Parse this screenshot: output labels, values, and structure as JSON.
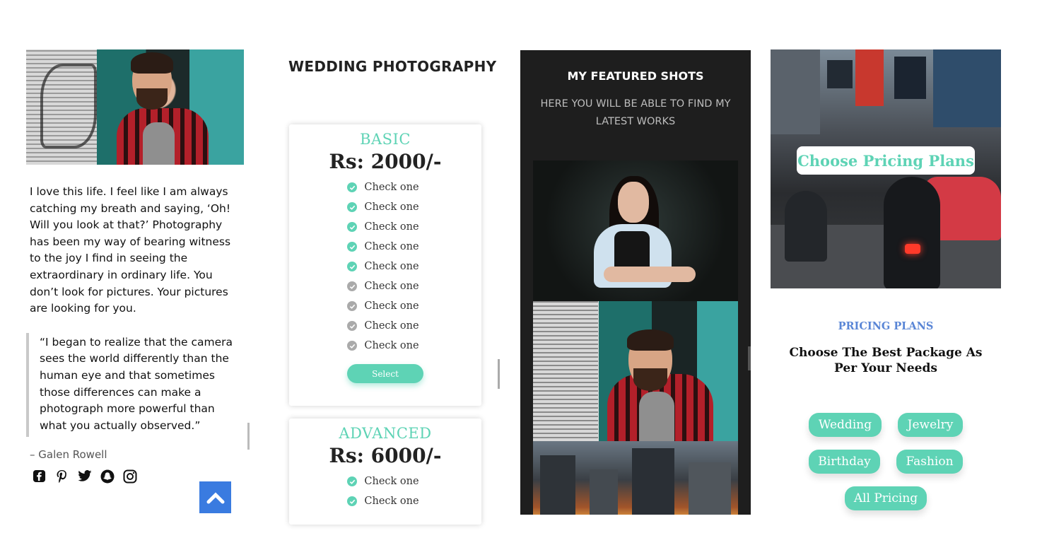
{
  "profile": {
    "bio": "I love this life. I feel like I am always catching my breath and saying, ‘Oh! Will you look at that?’ Photography has been my way of bearing witness to the joy I find in seeing the extraordinary in ordinary life. You don’t look for pictures. Your pictures are looking for you.",
    "quote": "“I began to realize that the camera sees the world differently than the human eye and that sometimes those differences can make a photograph more powerful than what you actually observed.”",
    "quote_author": "– Galen Rowell",
    "socials": [
      "facebook-icon",
      "pinterest-icon",
      "twitter-icon",
      "snapchat-icon",
      "instagram-icon"
    ]
  },
  "pricing_page": {
    "title": "WEDDING PHOTOGRAPHY",
    "plans": [
      {
        "name": "BASIC",
        "price": "Rs: 2000/-",
        "features": [
          {
            "label": "Check one",
            "included": true
          },
          {
            "label": "Check one",
            "included": true
          },
          {
            "label": "Check one",
            "included": true
          },
          {
            "label": "Check one",
            "included": true
          },
          {
            "label": "Check one",
            "included": true
          },
          {
            "label": "Check one",
            "included": false
          },
          {
            "label": "Check one",
            "included": false
          },
          {
            "label": "Check one",
            "included": false
          },
          {
            "label": "Check one",
            "included": false
          }
        ],
        "button": "Select"
      },
      {
        "name": "ADVANCED",
        "price": "Rs: 6000/-",
        "features": [
          {
            "label": "Check one",
            "included": true
          },
          {
            "label": "Check one",
            "included": true
          }
        ]
      }
    ]
  },
  "featured": {
    "title": "MY FEATURED SHOTS",
    "subtitle": "HERE YOU WILL BE ABLE TO FIND MY LATEST WORKS"
  },
  "pricing_plans": {
    "hero_label": "Choose Pricing Plans",
    "kicker": "PRICING PLANS",
    "heading": "Choose The Best Package As Per Your Needs",
    "categories": [
      "Wedding",
      "Jewelry",
      "Birthday",
      "Fashion",
      "All Pricing"
    ]
  },
  "colors": {
    "accent": "#5ed3b5",
    "link_blue": "#5a86d6",
    "scroll_top": "#3a7be0",
    "dark_panel": "#1e1e1e"
  }
}
